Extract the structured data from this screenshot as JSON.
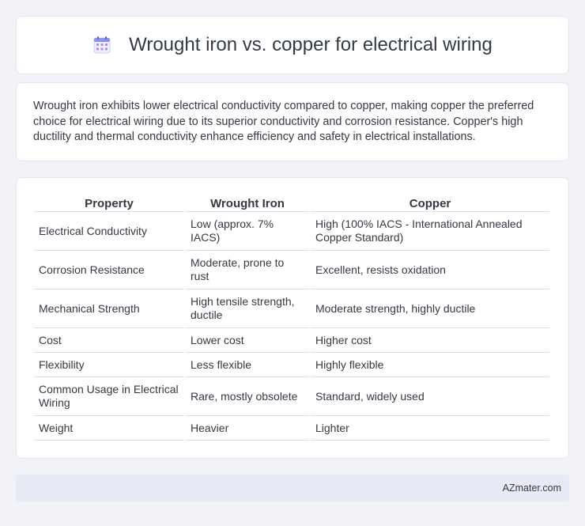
{
  "header": {
    "title": "Wrought iron vs. copper for electrical wiring",
    "icon": "calendar-icon"
  },
  "intro": {
    "text": "Wrought iron exhibits lower electrical conductivity compared to copper, making copper the preferred choice for electrical wiring due to its superior conductivity and corrosion resistance. Copper's high ductility and thermal conductivity enhance efficiency and safety in electrical installations."
  },
  "table": {
    "headers": [
      "Property",
      "Wrought Iron",
      "Copper"
    ],
    "rows": [
      [
        "Electrical Conductivity",
        "Low (approx. 7% IACS)",
        "High (100% IACS - International Annealed Copper Standard)"
      ],
      [
        "Corrosion Resistance",
        "Moderate, prone to rust",
        "Excellent, resists oxidation"
      ],
      [
        "Mechanical Strength",
        "High tensile strength, ductile",
        "Moderate strength, highly ductile"
      ],
      [
        "Cost",
        "Lower cost",
        "Higher cost"
      ],
      [
        "Flexibility",
        "Less flexible",
        "Highly flexible"
      ],
      [
        "Common Usage in Electrical Wiring",
        "Rare, mostly obsolete",
        "Standard, widely used"
      ],
      [
        "Weight",
        "Heavier",
        "Lighter"
      ]
    ]
  },
  "footer": {
    "text": "AZmater.com"
  },
  "colors": {
    "background": "#f1f3f8",
    "card": "#ffffff",
    "text": "#333a44",
    "footer_bg": "#e6ebf5"
  }
}
